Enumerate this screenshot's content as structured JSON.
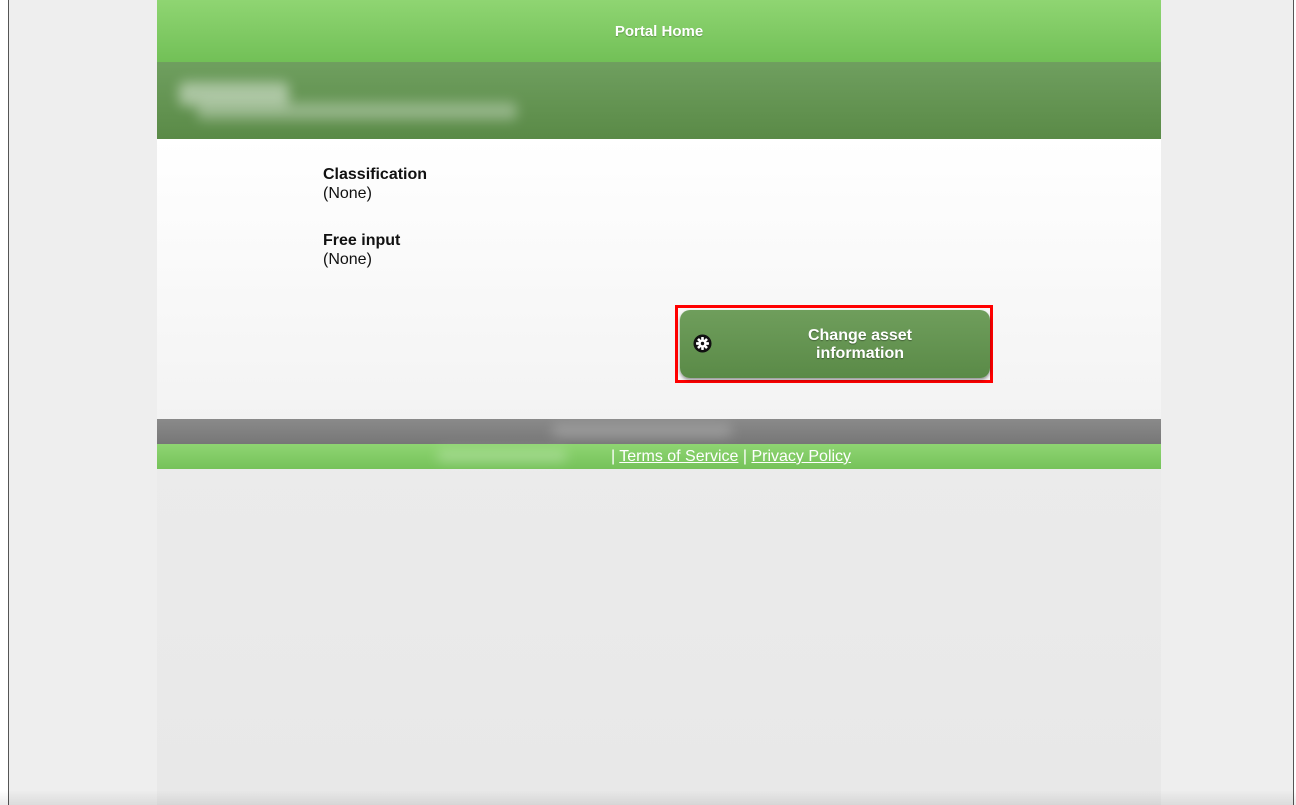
{
  "header": {
    "title": "Portal Home"
  },
  "asset": {
    "fields": [
      {
        "label": "Classification",
        "value": "(None)"
      },
      {
        "label": "Free input",
        "value": "(None)"
      }
    ],
    "change_button": {
      "line1": "Change asset",
      "line2": "information",
      "icon": "gear-icon"
    }
  },
  "footer": {
    "separator": "|",
    "terms_label": "Terms of Service",
    "privacy_label": "Privacy Policy"
  },
  "colors": {
    "header_green": "#8fd572",
    "subheader_green": "#5a8a47",
    "button_green": "#6f9e5c",
    "highlight_red": "#ff0000"
  }
}
